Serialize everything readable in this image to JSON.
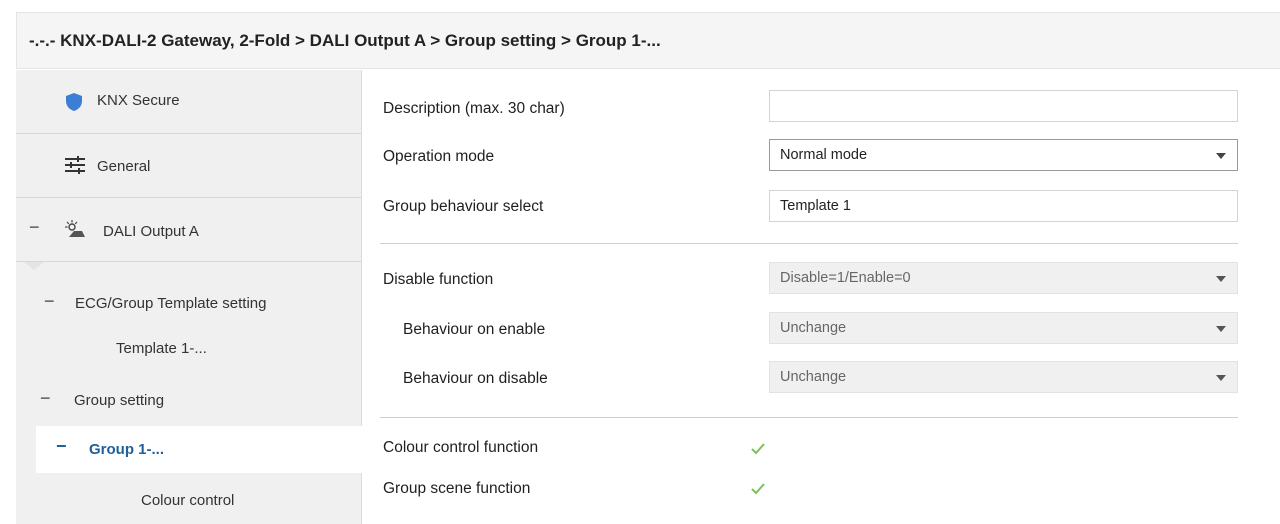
{
  "title": "-.-.- KNX-DALI-2 Gateway, 2-Fold > DALI Output A > Group setting > Group 1-...",
  "sidebar": {
    "items": [
      {
        "label": "KNX Secure",
        "icon": "shield-icon"
      },
      {
        "label": "General",
        "icon": "sliders-icon"
      },
      {
        "label": "DALI Output A",
        "icon": "dali-lamp-icon",
        "expander": "−"
      },
      {
        "label": "ECG/Group Template setting",
        "expander": "−"
      },
      {
        "label": "Template 1-..."
      },
      {
        "label": "Group setting",
        "expander": "−"
      },
      {
        "label": "Group 1-...",
        "expander": "−",
        "selected": true
      },
      {
        "label": "Colour control"
      }
    ]
  },
  "params": {
    "description": {
      "label": "Description (max. 30 char)",
      "value": ""
    },
    "operation_mode": {
      "label": "Operation mode",
      "value": "Normal mode"
    },
    "group_behaviour": {
      "label": "Group behaviour select",
      "value": "Template 1"
    },
    "disable_function": {
      "label": "Disable function",
      "value": "Disable=1/Enable=0"
    },
    "behaviour_enable": {
      "label": "Behaviour on enable",
      "value": "Unchange"
    },
    "behaviour_disable": {
      "label": "Behaviour on disable",
      "value": "Unchange"
    },
    "colour_control": {
      "label": "Colour control function",
      "checked": true
    },
    "group_scene": {
      "label": "Group scene function",
      "checked": true
    }
  },
  "colors": {
    "accent": "#1f5f9c",
    "shield": "#3a7fd5",
    "check": "#7fbf5f"
  }
}
